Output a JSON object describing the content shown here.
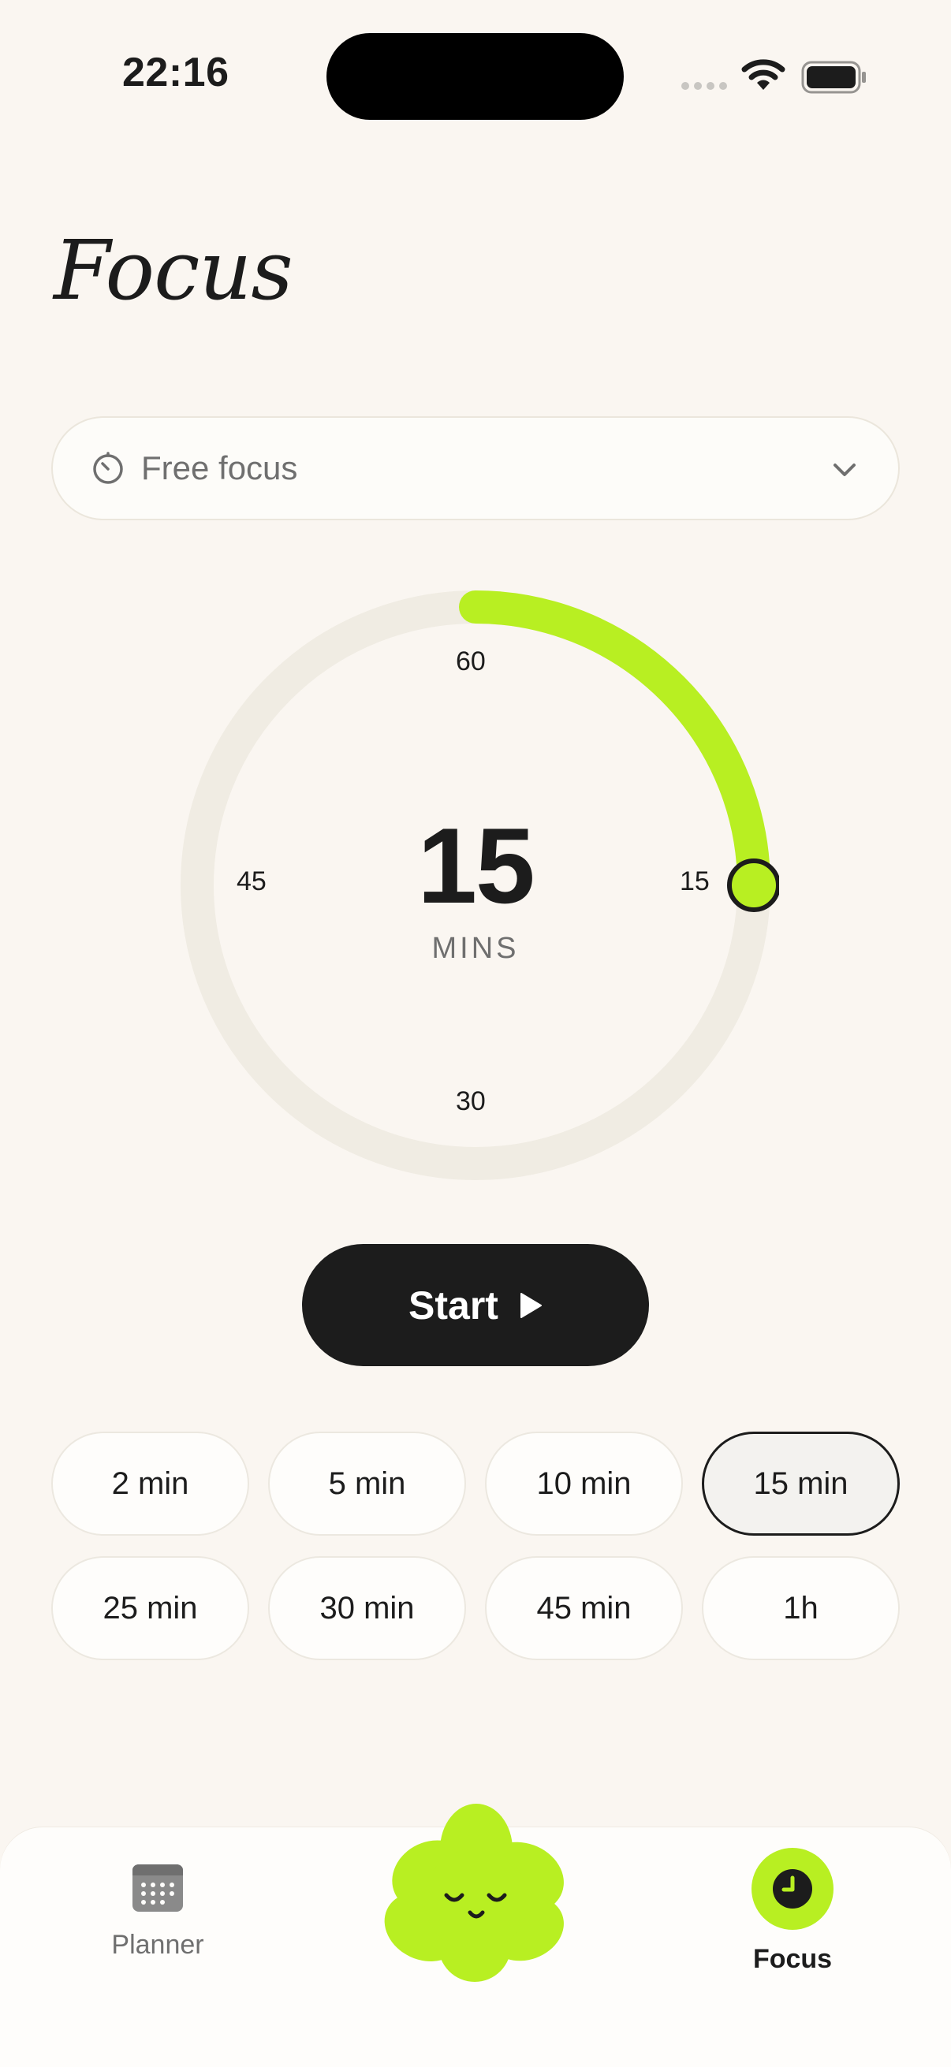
{
  "status_bar": {
    "time": "22:16"
  },
  "page": {
    "title": "Focus"
  },
  "mode_select": {
    "selected": "Free focus"
  },
  "dial": {
    "value": "15",
    "unit": "MINS",
    "ticks": {
      "top": "60",
      "right": "15",
      "bottom": "30",
      "left": "45"
    },
    "fraction": 0.25,
    "track_color": "#f0ece3",
    "progress_color": "#b8ef22"
  },
  "start_button": {
    "label": "Start"
  },
  "presets": [
    {
      "label": "2 min",
      "selected": false
    },
    {
      "label": "5 min",
      "selected": false
    },
    {
      "label": "10 min",
      "selected": false
    },
    {
      "label": "15 min",
      "selected": true
    },
    {
      "label": "25 min",
      "selected": false
    },
    {
      "label": "30 min",
      "selected": false
    },
    {
      "label": "45 min",
      "selected": false
    },
    {
      "label": "1h",
      "selected": false
    }
  ],
  "tab_bar": {
    "items": [
      {
        "label": "Planner",
        "icon": "calendar-icon",
        "active": false
      },
      {
        "label": "Focus",
        "icon": "clock-icon",
        "active": true
      }
    ],
    "center_icon": "flower-mascot-icon"
  },
  "colors": {
    "accent": "#b8ef22",
    "background": "#faf6f1",
    "ink": "#1c1c1c"
  }
}
